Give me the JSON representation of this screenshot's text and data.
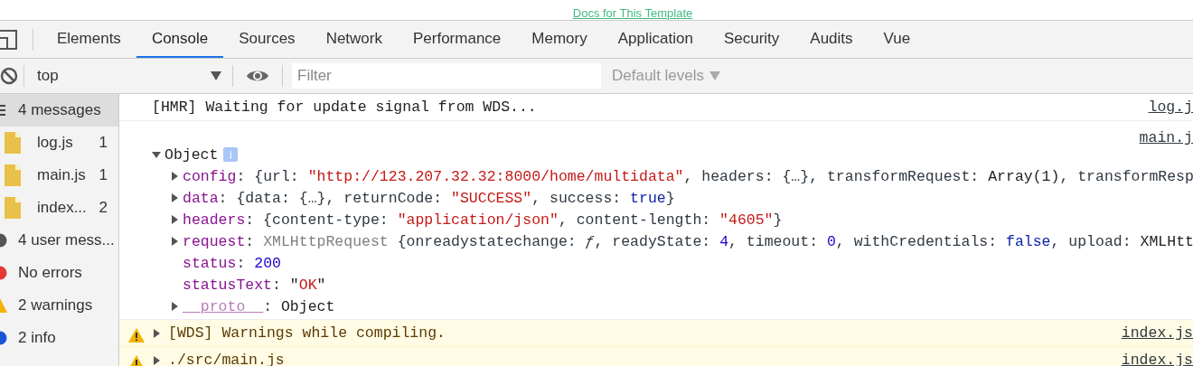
{
  "page_link": "Docs for This Template",
  "tabs": [
    {
      "label": "Elements",
      "selected": false
    },
    {
      "label": "Console",
      "selected": true
    },
    {
      "label": "Sources",
      "selected": false
    },
    {
      "label": "Network",
      "selected": false
    },
    {
      "label": "Performance",
      "selected": false
    },
    {
      "label": "Memory",
      "selected": false
    },
    {
      "label": "Application",
      "selected": false
    },
    {
      "label": "Security",
      "selected": false
    },
    {
      "label": "Audits",
      "selected": false
    },
    {
      "label": "Vue",
      "selected": false
    }
  ],
  "toolbar": {
    "context": "top",
    "filter_placeholder": "Filter",
    "levels": "Default levels"
  },
  "sidebar": {
    "items": [
      {
        "kind": "list",
        "label": "4 messages",
        "selected": true,
        "children": [
          {
            "kind": "file",
            "label": "log.js",
            "count": "1",
            "selected": false
          },
          {
            "kind": "file",
            "label": "main.js",
            "count": "1",
            "selected": false
          },
          {
            "kind": "file",
            "label": "index...",
            "count": "2",
            "selected": false
          }
        ]
      },
      {
        "kind": "user",
        "label": "4 user mess...",
        "selected": false
      },
      {
        "kind": "error",
        "label": "No errors",
        "selected": false
      },
      {
        "kind": "warning",
        "label": "2 warnings",
        "selected": false
      },
      {
        "kind": "info",
        "label": "2 info",
        "selected": false
      }
    ]
  },
  "messages": [
    {
      "kind": "log",
      "source": "log.j",
      "segments": [
        {
          "kind": "dark",
          "text": "[HMR] Waiting for update signal from WDS..."
        }
      ]
    },
    {
      "kind": "object",
      "source": "main.j",
      "label": "Object",
      "badge": "i",
      "expanded": true,
      "children": [
        {
          "expanded": false,
          "segments": [
            {
              "kind": "key",
              "text": "config"
            },
            {
              "kind": "plain",
              "text": ": {url: "
            },
            {
              "kind": "string",
              "text": "\"http://123.207.32.32:8000/home/multidata\""
            },
            {
              "kind": "plain",
              "text": ", headers: {…}, transformRequest: "
            },
            {
              "kind": "dark",
              "text": "Array(1)"
            },
            {
              "kind": "plain",
              "text": ", transformResp"
            }
          ]
        },
        {
          "expanded": false,
          "segments": [
            {
              "kind": "key",
              "text": "data"
            },
            {
              "kind": "plain",
              "text": ": {data: {…}, returnCode: "
            },
            {
              "kind": "string",
              "text": "\"SUCCESS\""
            },
            {
              "kind": "plain",
              "text": ", success: "
            },
            {
              "kind": "keyword",
              "text": "true"
            },
            {
              "kind": "plain",
              "text": "}"
            }
          ]
        },
        {
          "expanded": false,
          "segments": [
            {
              "kind": "key",
              "text": "headers"
            },
            {
              "kind": "plain",
              "text": ": {content-type: "
            },
            {
              "kind": "string",
              "text": "\"application/json\""
            },
            {
              "kind": "plain",
              "text": ", content-length: "
            },
            {
              "kind": "string",
              "text": "\"4605\""
            },
            {
              "kind": "plain",
              "text": "}"
            }
          ]
        },
        {
          "expanded": false,
          "segments": [
            {
              "kind": "key",
              "text": "request"
            },
            {
              "kind": "plain",
              "text": ": "
            },
            {
              "kind": "dim",
              "text": "XMLHttpRequest"
            },
            {
              "kind": "plain",
              "text": " {onreadystatechange: "
            },
            {
              "kind": "italic",
              "text": "ƒ"
            },
            {
              "kind": "plain",
              "text": ", readyState: "
            },
            {
              "kind": "number",
              "text": "4"
            },
            {
              "kind": "plain",
              "text": ", timeout: "
            },
            {
              "kind": "number",
              "text": "0"
            },
            {
              "kind": "plain",
              "text": ", withCredentials: "
            },
            {
              "kind": "keyword",
              "text": "false"
            },
            {
              "kind": "plain",
              "text": ", upload: "
            },
            {
              "kind": "dark",
              "text": "XMLHtt"
            }
          ]
        },
        {
          "segments": [
            {
              "kind": "key",
              "text": "status"
            },
            {
              "kind": "plain",
              "text": ": "
            },
            {
              "kind": "number",
              "text": "200"
            }
          ]
        },
        {
          "segments": [
            {
              "kind": "key",
              "text": "statusText"
            },
            {
              "kind": "plain",
              "text": ": "
            },
            {
              "kind": "dark",
              "text": "\""
            },
            {
              "kind": "string",
              "text": "OK"
            },
            {
              "kind": "dark",
              "text": "\""
            }
          ]
        },
        {
          "expanded": false,
          "segments": [
            {
              "kind": "proto",
              "text": "__proto__"
            },
            {
              "kind": "plain",
              "text": ": "
            },
            {
              "kind": "dark",
              "text": "Object"
            }
          ]
        }
      ]
    },
    {
      "kind": "warning",
      "source": "index.js",
      "expanded": false,
      "segments": [
        {
          "kind": "warn",
          "text": "[WDS] Warnings while compiling."
        }
      ]
    },
    {
      "kind": "warning",
      "source": "index.js",
      "expanded": false,
      "segments": [
        {
          "kind": "warn",
          "text": "./src/main.js"
        }
      ]
    }
  ]
}
